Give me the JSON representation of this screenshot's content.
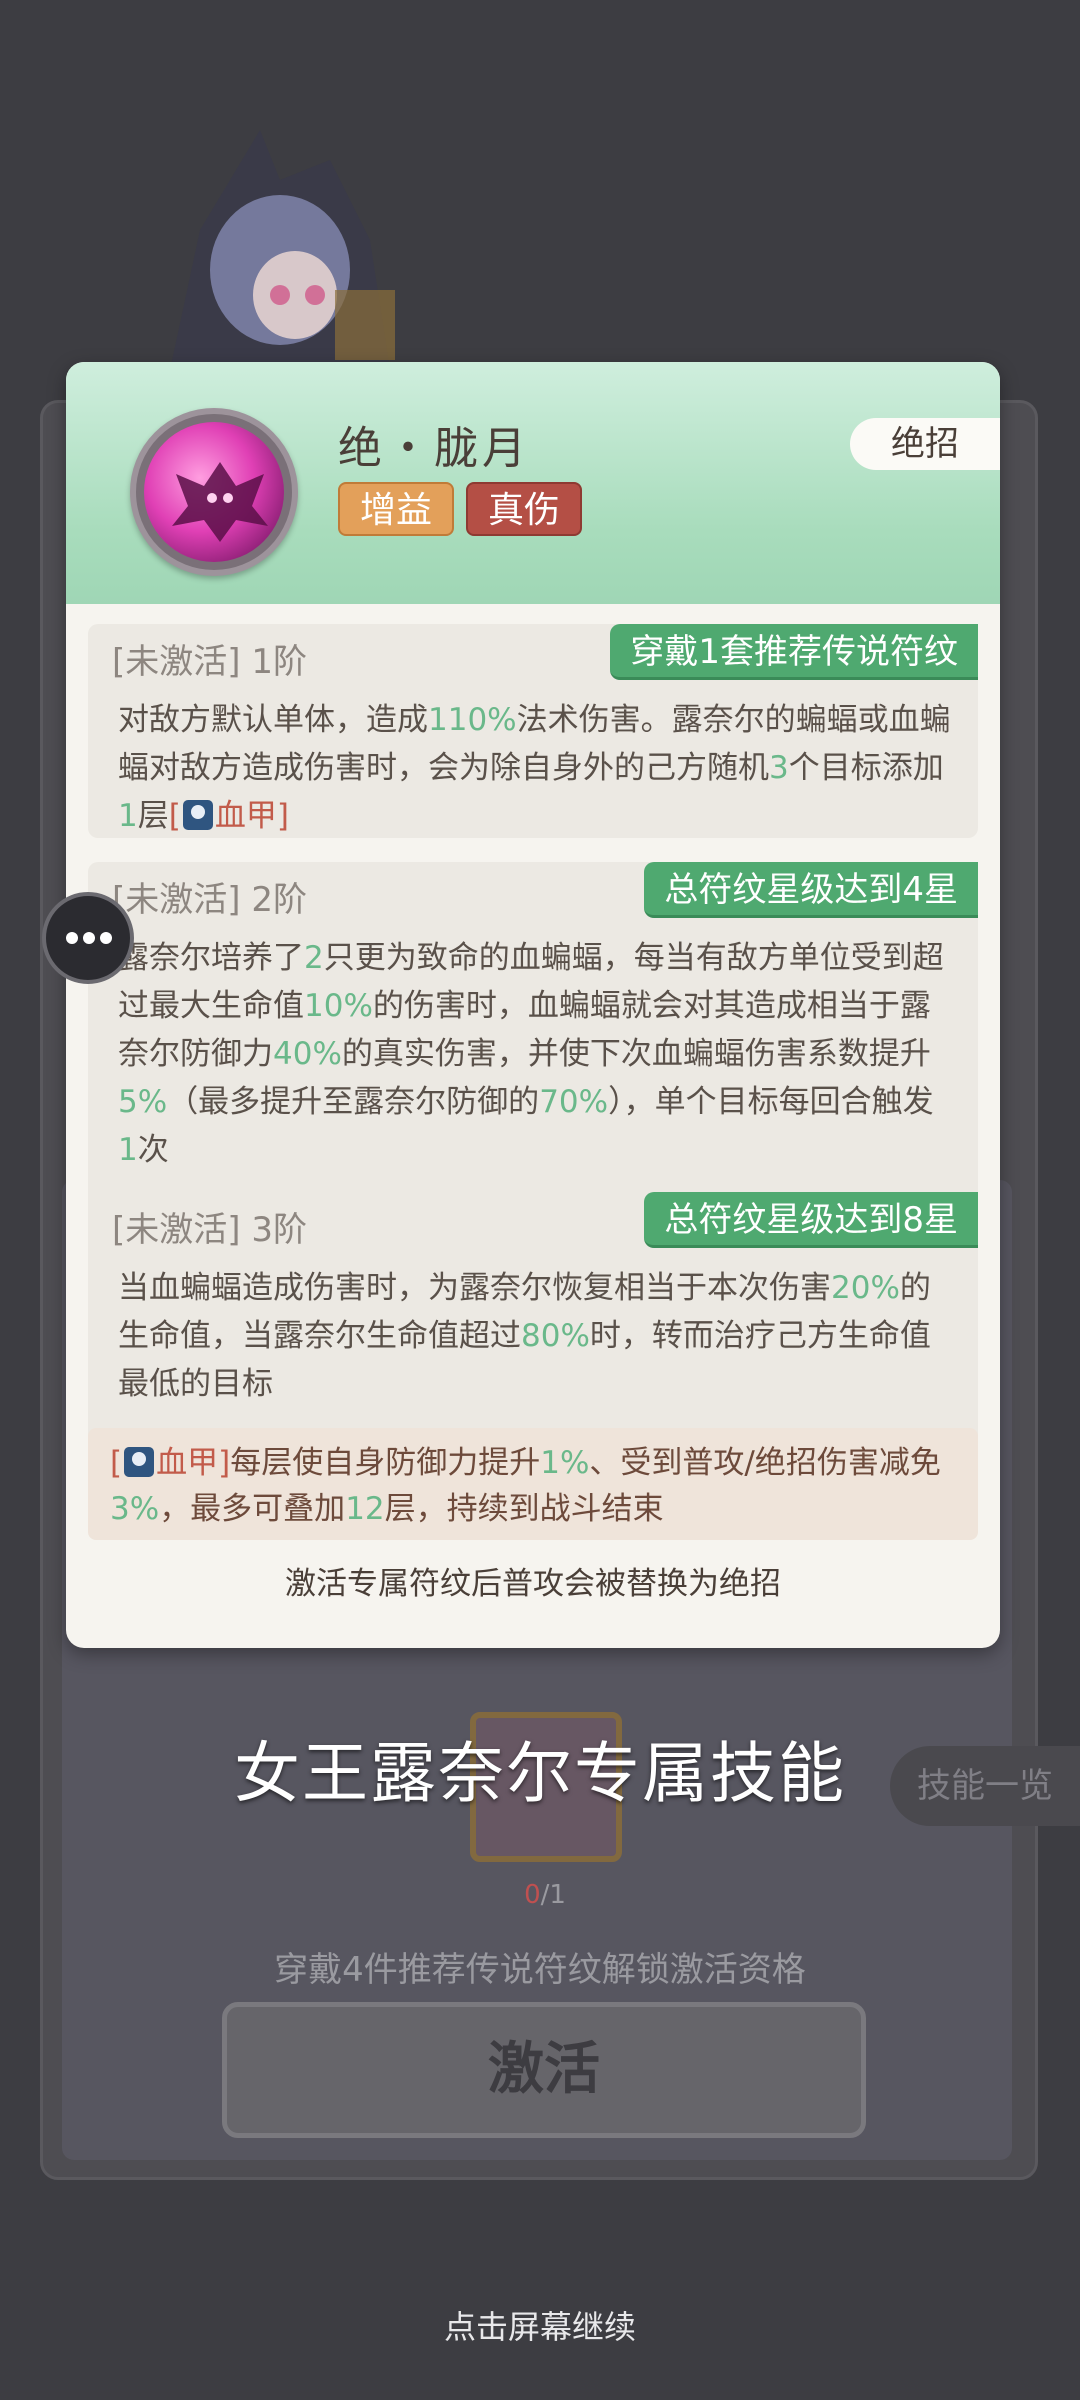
{
  "skill": {
    "name": "绝・胧月",
    "tags": [
      "增益",
      "真伤"
    ],
    "type_badge": "绝招"
  },
  "tiers": [
    {
      "status": "[未激活]",
      "level": "1阶",
      "requirement": "穿戴1套推荐传说符纹",
      "segments": [
        "对敌方默认单体，造成",
        "110%",
        "法术伤害。露奈尔的蝙蝠或血蝙蝠对敌方造成伤害时，会为除自身外的己方随机",
        "3",
        "个目标添加",
        "1",
        "层",
        "[",
        "血甲",
        "]"
      ]
    },
    {
      "status": "[未激活]",
      "level": "2阶",
      "requirement": "总符纹星级达到4星",
      "segments": [
        "露奈尔培养了",
        "2",
        "只更为致命的血蝙蝠，每当有敌方单位受到超过最大生命值",
        "10%",
        "的伤害时，血蝙蝠就会对其造成相当于露奈尔防御力",
        "40%",
        "的真实伤害，并使下次血蝙蝠伤害系数提升",
        "5%",
        "（最多提升至露奈尔防御的",
        "70%",
        "），单个目标每回合触发",
        "1",
        "次"
      ]
    },
    {
      "status": "[未激活]",
      "level": "3阶",
      "requirement": "总符纹星级达到8星",
      "segments": [
        "当血蝙蝠造成伤害时，为露奈尔恢复相当于本次伤害",
        "20%",
        "的生命值，当露奈尔生命值超过",
        "80%",
        "时，转而治疗己方生命值最低的目标"
      ]
    }
  ],
  "buff_note": {
    "segments": [
      "[",
      "血甲",
      "]",
      "每层使自身防御力提升",
      "1%",
      "、受到普攻/绝招伤害减免",
      "3%",
      "，最多可叠加",
      "12",
      "层，持续到战斗结束"
    ]
  },
  "footer_note": "激活专属符纹后普攻会被替换为绝招",
  "caption": "女王露奈尔专属技能",
  "rune": {
    "count_current": "0",
    "count_total": "/1"
  },
  "skill_list_label": "技能一览",
  "unlock_text": "穿戴4件推荐传说符纹解锁激活资格",
  "activate_label": "激活",
  "continue_text": "点击屏幕继续"
}
